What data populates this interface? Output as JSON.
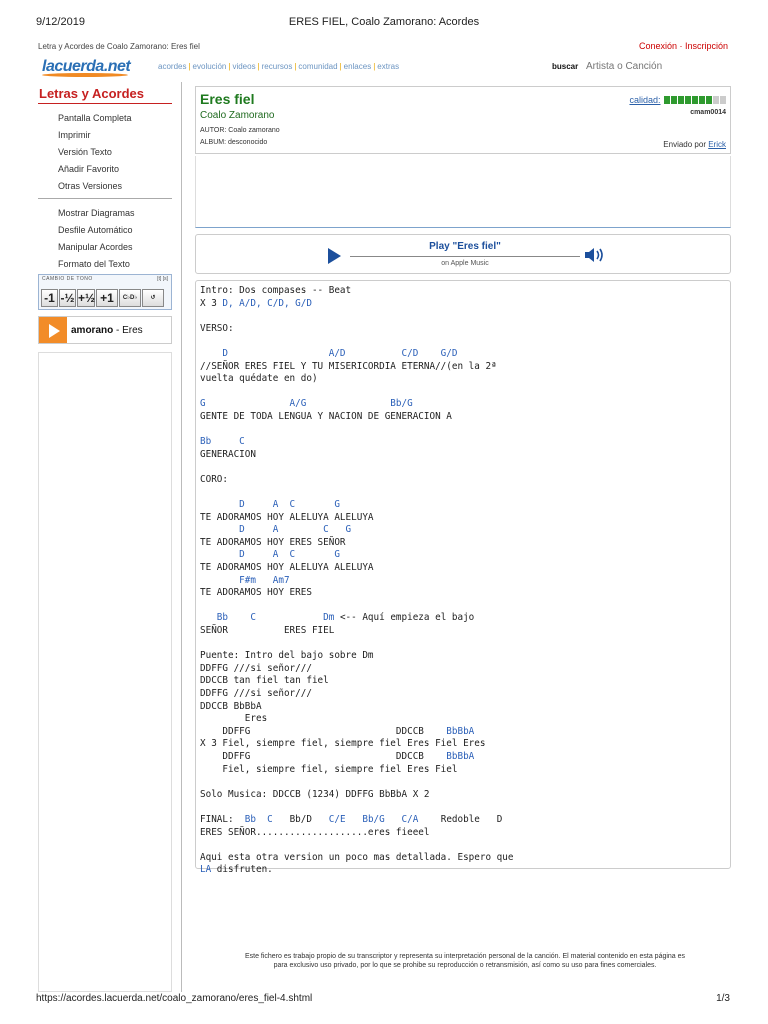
{
  "print": {
    "date": "9/12/2019",
    "title": "ERES FIEL, Coalo Zamorano: Acordes",
    "url": "https://acordes.lacuerda.net/coalo_zamorano/eres_fiel-4.shtml",
    "page": "1/3"
  },
  "header": {
    "breadcrumb": "Letra y Acordes de Coalo Zamorano: Eres fiel",
    "login": "Conexión · Inscripción",
    "logo": "lacuerda.net",
    "nav": [
      "acordes",
      "evolución",
      "videos",
      "recursos",
      "comunidad",
      "enlaces",
      "extras"
    ],
    "search_label": "buscar",
    "search_placeholder": "Artista o Canción"
  },
  "sidebar": {
    "title": "Letras y Acordes",
    "group1": [
      "Pantalla Completa",
      "Imprimir",
      "Versión Texto",
      "Añadir Favorito",
      "Otras Versiones"
    ],
    "group2": [
      "Mostrar Diagramas",
      "Desfile Automático",
      "Manipular Acordes",
      "Formato del Texto"
    ],
    "cambio_label": "CAMBIO DE TONO",
    "cambio_marks": "[t] [s]",
    "tone_buttons": [
      "-1",
      "-½",
      "+½",
      "+1",
      "C♭D♭",
      "↺"
    ],
    "player_artist": "amorano",
    "player_song": "- Eres"
  },
  "song": {
    "title": "Eres fiel",
    "artist": "Coalo Zamorano",
    "autor": "AUTOR: Coalo zamorano",
    "album": "ALBUM: desconocido",
    "quality_label": "calidad:",
    "quality_level": 7,
    "quality_max": 9,
    "user_id": "cmam0014",
    "sent_by_label": "Enviado por",
    "sent_by_user": "Erick"
  },
  "player": {
    "title": "Play \"Eres fiel\"",
    "subtitle": "on Apple Music"
  },
  "lyrics": [
    {
      "t": "Intro: Dos compases -- Beat"
    },
    {
      "t": "X 3 ",
      "c": "D, A/D, C/D, G/D"
    },
    {
      "t": ""
    },
    {
      "t": "VERSO:"
    },
    {
      "t": ""
    },
    {
      "c": "    D                  A/D          C/D    G/D"
    },
    {
      "t": "//SEÑOR ERES FIEL Y TU MISERICORDIA ETERNA//(en la 2ª"
    },
    {
      "t": "vuelta quédate en do)"
    },
    {
      "t": ""
    },
    {
      "c": "G               A/G               Bb/G"
    },
    {
      "t": "GENTE DE TODA LENGUA Y NACION DE GENERACION A"
    },
    {
      "t": ""
    },
    {
      "c": "Bb     C"
    },
    {
      "t": "GENERACION"
    },
    {
      "t": ""
    },
    {
      "t": "CORO:"
    },
    {
      "t": ""
    },
    {
      "c": "       D     A  C       G"
    },
    {
      "t": "TE ADORAMOS HOY ALELUYA ALELUYA"
    },
    {
      "c": "       D     A        C   G"
    },
    {
      "t": "TE ADORAMOS HOY ERES SEÑOR"
    },
    {
      "c": "       D     A  C       G"
    },
    {
      "t": "TE ADORAMOS HOY ALELUYA ALELUYA"
    },
    {
      "c": "       F#m   Am7"
    },
    {
      "t": "TE ADORAMOS HOY ERES"
    },
    {
      "t": ""
    },
    {
      "c": "   Bb    C            Dm",
      "t2": " <-- Aquí empieza el bajo"
    },
    {
      "t": "SEÑOR          ERES FIEL"
    },
    {
      "t": ""
    },
    {
      "t": "Puente: Intro del bajo sobre Dm"
    },
    {
      "t": "DDFFG ///si señor///"
    },
    {
      "t": "DDCCB tan fiel tan fiel"
    },
    {
      "t": "DDFFG ///si señor///"
    },
    {
      "t": "DDCCB BbBbA"
    },
    {
      "t": "        Eres"
    },
    {
      "t": "    DDFFG                          DDCCB    ",
      "c2": "BbBbA"
    },
    {
      "t": "X 3 Fiel, siempre fiel, siempre fiel Eres Fiel Eres"
    },
    {
      "t": "    DDFFG                          DDCCB    ",
      "c2": "BbBbA"
    },
    {
      "t": "    Fiel, siempre fiel, siempre fiel Eres Fiel"
    },
    {
      "t": ""
    },
    {
      "t": "Solo Musica: DDCCB (1234) DDFFG BbBbA X 2"
    },
    {
      "t": ""
    },
    {
      "t": "FINAL:  ",
      "c": "Bb  C",
      "t3": "   Bb/D   ",
      "c3": "C/E   Bb/G   C/A",
      "t4": "    Redoble   D"
    },
    {
      "t": "ERES SEÑOR....................eres fieeel"
    },
    {
      "t": ""
    },
    {
      "t": "Aqui esta otra version un poco mas detallada. Espero que"
    },
    {
      "c": "LA",
      "t2": " disfruten."
    }
  ],
  "footer": {
    "line1": "Este fichero es trabajo propio de su transcriptor y representa su interpretación personal de la canción. El material contenido en esta página es",
    "line2": "para exclusivo uso privado, por lo que se prohibe su reproducción o retransmisión, así como su uso para fines comerciales."
  },
  "colors": {
    "title_green": "#1f7a1f",
    "chord_blue": "#2a5fb8",
    "sidebar_red": "#c62020",
    "quality_green": "#2f9a2f",
    "quality_empty": "#cccccc"
  }
}
